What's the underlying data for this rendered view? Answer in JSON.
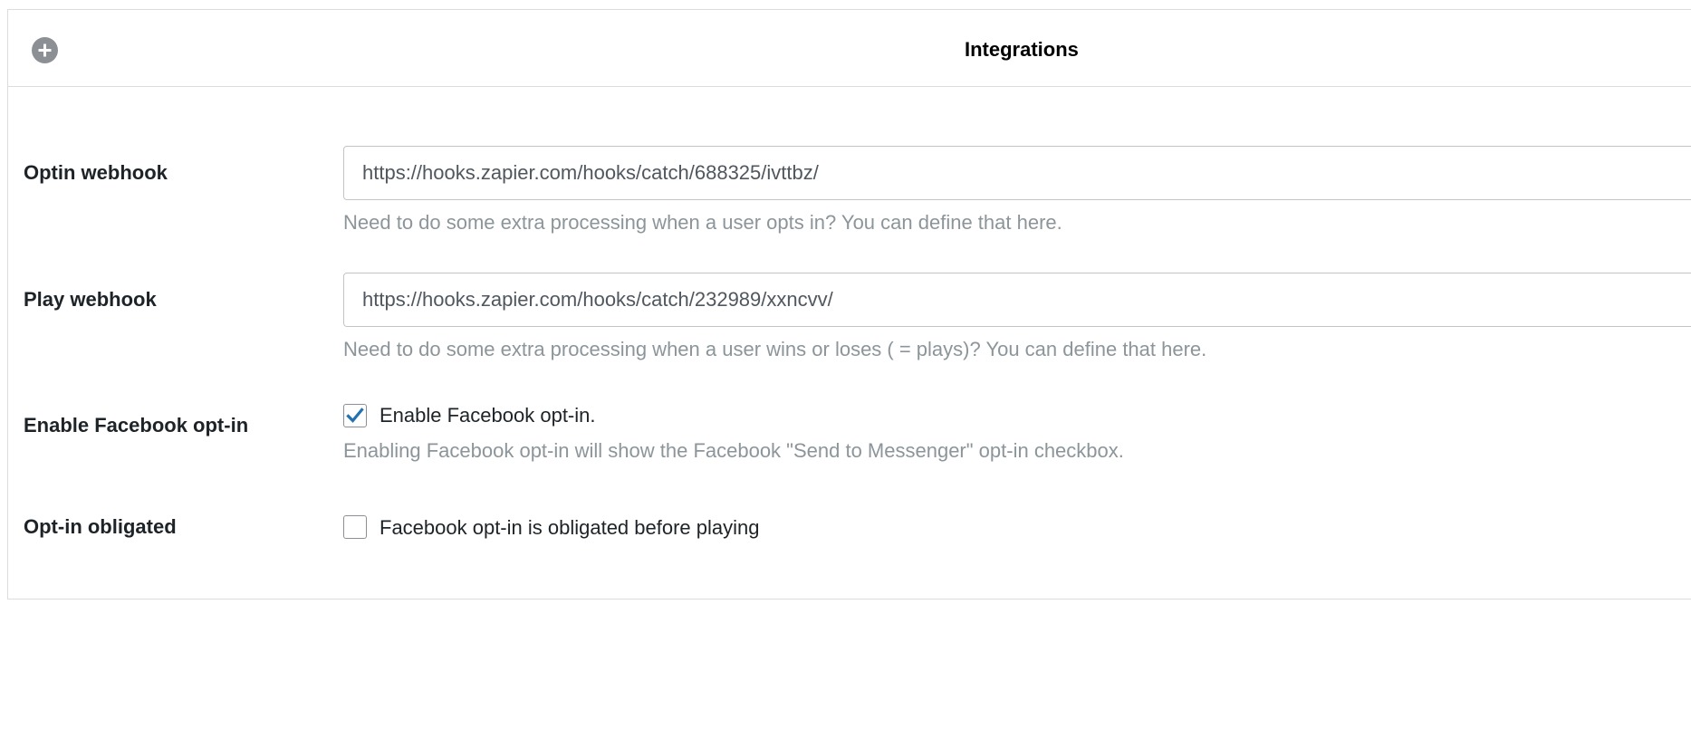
{
  "panel": {
    "title": "Integrations",
    "toggle_icon": "plus-circle-icon"
  },
  "fields": {
    "optin_webhook": {
      "label": "Optin webhook",
      "value": "https://hooks.zapier.com/hooks/catch/688325/ivttbz/",
      "help": "Need to do some extra processing when a user opts in? You can define that here."
    },
    "play_webhook": {
      "label": "Play webhook",
      "value": "https://hooks.zapier.com/hooks/catch/232989/xxncvv/",
      "help": "Need to do some extra processing when a user wins or loses ( = plays)? You can define that here."
    },
    "facebook_optin": {
      "label": "Enable Facebook opt-in",
      "checkbox_label": "Enable Facebook opt-in.",
      "checked": true,
      "help": "Enabling Facebook opt-in will show the Facebook \"Send to Messenger\" opt-in checkbox."
    },
    "optin_obligated": {
      "label": "Opt-in obligated",
      "checkbox_label": "Facebook opt-in is obligated before playing",
      "checked": false
    }
  },
  "colors": {
    "checkmark": "#2271b1",
    "help_text": "#8c9599",
    "toggle_bg": "#8c8f94"
  }
}
